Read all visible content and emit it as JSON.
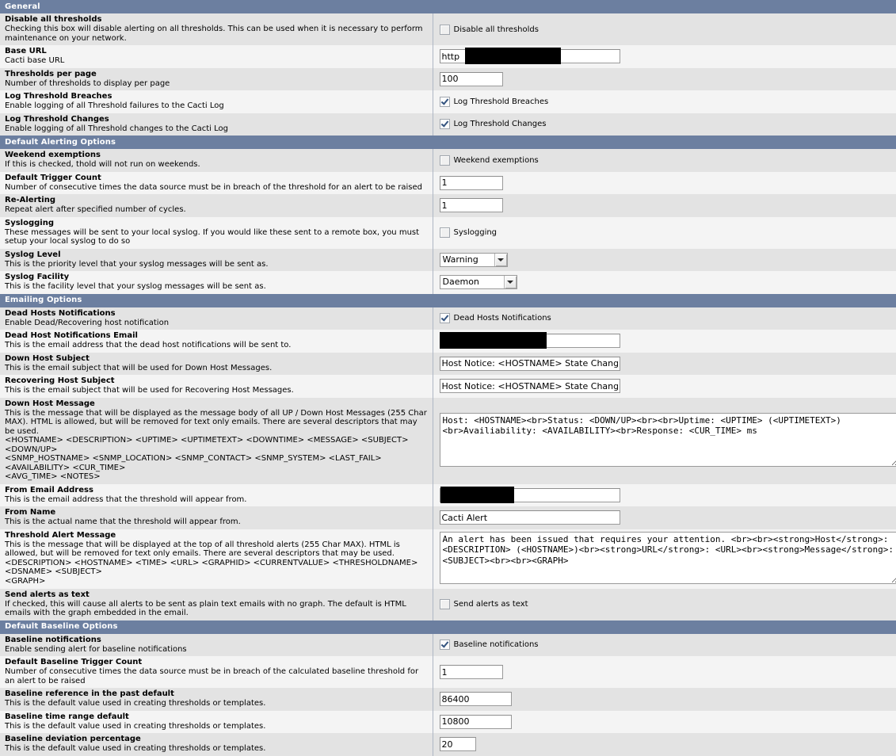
{
  "sections": [
    {
      "id": "general",
      "title": "General",
      "rows": [
        {
          "name": "disable-all-thresholds",
          "title": "Disable all thresholds",
          "desc": "Checking this box will disable alerting on all thresholds. This can be used when it is necessary to perform maintenance on your network.",
          "control": "checkbox",
          "checked": false,
          "checkbox_label": "Disable all thresholds"
        },
        {
          "name": "base-url",
          "title": "Base URL",
          "desc": "Cacti base URL",
          "control": "text-redacted-baseurl",
          "value": "http",
          "width": "w-lg"
        },
        {
          "name": "thresholds-per-page",
          "title": "Thresholds per page",
          "desc": "Number of thresholds to display per page",
          "control": "text",
          "value": "100",
          "width": "w-md"
        },
        {
          "name": "log-threshold-breaches",
          "title": "Log Threshold Breaches",
          "desc": "Enable logging of all Threshold failures to the Cacti Log",
          "control": "checkbox",
          "checked": true,
          "checkbox_label": "Log Threshold Breaches"
        },
        {
          "name": "log-threshold-changes",
          "title": "Log Threshold Changes",
          "desc": "Enable logging of all Threshold changes to the Cacti Log",
          "control": "checkbox",
          "checked": true,
          "checkbox_label": "Log Threshold Changes"
        }
      ]
    },
    {
      "id": "default-alerting-options",
      "title": "Default Alerting Options",
      "rows": [
        {
          "name": "weekend-exemptions",
          "title": "Weekend exemptions",
          "desc": "If this is checked, thold will not run on weekends.",
          "control": "checkbox",
          "checked": false,
          "checkbox_label": "Weekend exemptions"
        },
        {
          "name": "default-trigger-count",
          "title": "Default Trigger Count",
          "desc": "Number of consecutive times the data source must be in breach of the threshold for an alert to be raised",
          "control": "text",
          "value": "1",
          "width": "w-md"
        },
        {
          "name": "re-alerting",
          "title": "Re-Alerting",
          "desc": "Repeat alert after specified number of cycles.",
          "control": "text",
          "value": "1",
          "width": "w-md"
        },
        {
          "name": "syslogging",
          "title": "Syslogging",
          "desc": "These messages will be sent to your local syslog. If you would like these sent to a remote box, you must setup your local syslog to do so",
          "control": "checkbox",
          "checked": false,
          "checkbox_label": "Syslogging"
        },
        {
          "name": "syslog-level",
          "title": "Syslog Level",
          "desc": "This is the priority level that your syslog messages will be sent as.",
          "control": "select",
          "value": "Warning"
        },
        {
          "name": "syslog-facility",
          "title": "Syslog Facility",
          "desc": "This is the facility level that your syslog messages will be sent as.",
          "control": "select-wide",
          "value": "Daemon"
        }
      ]
    },
    {
      "id": "emailing-options",
      "title": "Emailing Options",
      "rows": [
        {
          "name": "dead-hosts-notifications",
          "title": "Dead Hosts Notifications",
          "desc": "Enable Dead/Recovering host notification",
          "control": "checkbox",
          "checked": true,
          "checkbox_label": "Dead Hosts Notifications"
        },
        {
          "name": "dead-host-notifications-email",
          "title": "Dead Host Notifications Email",
          "desc": "This is the email address that the dead host notifications will be sent to.",
          "control": "text-redacted-email",
          "value": "",
          "width": "w-lg"
        },
        {
          "name": "down-host-subject",
          "title": "Down Host Subject",
          "desc": "This is the email subject that will be used for Down Host Messages.",
          "control": "text",
          "value": "Host Notice: <HOSTNAME> State Change",
          "width": "w-lg"
        },
        {
          "name": "recovering-host-subject",
          "title": "Recovering Host Subject",
          "desc": "This is the email subject that will be used for Recovering Host Messages.",
          "control": "text",
          "value": "Host Notice: <HOSTNAME> State Change",
          "width": "w-lg"
        },
        {
          "name": "down-host-message",
          "title": "Down Host Message",
          "desc": "This is the message that will be displayed as the message body of all UP / Down Host Messages (255 Char MAX). HTML is allowed, but will be removed for text only emails. There are several descriptors that may be used.",
          "descriptors": [
            "<HOSTNAME> <DESCRIPTION> <UPTIME> <UPTIMETEXT> <DOWNTIME> <MESSAGE> <SUBJECT> <DOWN/UP>",
            "<SNMP_HOSTNAME> <SNMP_LOCATION> <SNMP_CONTACT> <SNMP_SYSTEM> <LAST_FAIL> <AVAILABILITY> <CUR_TIME>",
            "<AVG_TIME> <NOTES>"
          ],
          "control": "textarea-down",
          "value": "Host: <HOSTNAME><br>Status: <DOWN/UP><br><br>Uptime: <UPTIME> (<UPTIMETEXT>)<br>Availiability: <AVAILABILITY><br>Response: <CUR_TIME> ms"
        },
        {
          "name": "from-email-address",
          "title": "From Email Address",
          "desc": "This is the email address that the threshold will appear from.",
          "control": "text-redacted-from",
          "value": "",
          "width": "w-lg"
        },
        {
          "name": "from-name",
          "title": "From Name",
          "desc": "This is the actual name that the threshold will appear from.",
          "control": "text",
          "value": "Cacti Alert",
          "width": "w-lg"
        },
        {
          "name": "threshold-alert-message",
          "title": "Threshold Alert Message",
          "desc": "This is the message that will be displayed at the top of all threshold alerts (255 Char MAX). HTML is allowed, but will be removed for text only emails. There are several descriptors that may be used.",
          "descriptors": [
            "<DESCRIPTION> <HOSTNAME> <TIME> <URL> <GRAPHID> <CURRENTVALUE> <THRESHOLDNAME> <DSNAME> <SUBJECT>",
            "<GRAPH>"
          ],
          "control": "textarea-alert",
          "value": "An alert has been issued that requires your attention. <br><br><strong>Host</strong>: <DESCRIPTION> (<HOSTNAME>)<br><strong>URL</strong>: <URL><br><strong>Message</strong>: <SUBJECT><br><br><GRAPH>"
        },
        {
          "name": "send-alerts-as-text",
          "title": "Send alerts as text",
          "desc": "If checked, this will cause all alerts to be sent as plain text emails with no graph. The default is HTML emails with the graph embedded in the email.",
          "control": "checkbox",
          "checked": false,
          "checkbox_label": "Send alerts as text"
        }
      ]
    },
    {
      "id": "default-baseline-options",
      "title": "Default Baseline Options",
      "rows": [
        {
          "name": "baseline-notifications",
          "title": "Baseline notifications",
          "desc": "Enable sending alert for baseline notifications",
          "control": "checkbox",
          "checked": true,
          "checkbox_label": "Baseline notifications"
        },
        {
          "name": "default-baseline-trigger-count",
          "title": "Default Baseline Trigger Count",
          "desc": "Number of consecutive times the data source must be in breach of the calculated baseline threshold for an alert to be raised",
          "control": "text",
          "value": "1",
          "width": "w-md"
        },
        {
          "name": "baseline-reference-in-the-past-default",
          "title": "Baseline reference in the past default",
          "desc": "This is the default value used in creating thresholds or templates.",
          "control": "text",
          "value": "86400",
          "width": "w-md2"
        },
        {
          "name": "baseline-time-range-default",
          "title": "Baseline time range default",
          "desc": "This is the default value used in creating thresholds or templates.",
          "control": "text",
          "value": "10800",
          "width": "w-md2"
        },
        {
          "name": "baseline-deviation-percentage",
          "title": "Baseline deviation percentage",
          "desc": "This is the default value used in creating thresholds or templates.",
          "control": "text",
          "value": "20",
          "width": "w-sm2"
        }
      ]
    }
  ],
  "colors": {
    "section_header_bg": "#6c7fa0",
    "row_odd_bg": "#e3e3e3",
    "row_even_bg": "#f4f4f4",
    "redaction": "#000000",
    "checkbox_check": "#33537f"
  }
}
